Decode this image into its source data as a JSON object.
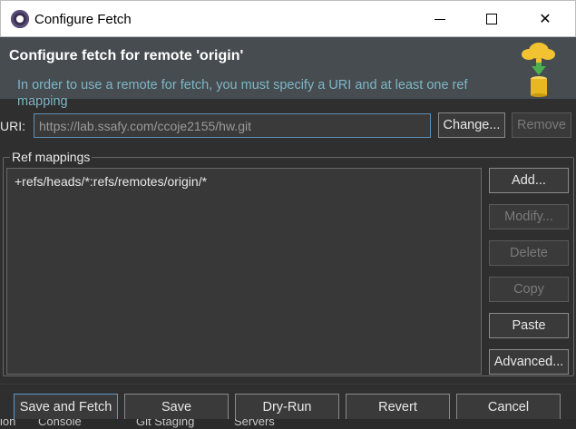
{
  "window": {
    "title": "Configure Fetch",
    "close_glyph": "✕"
  },
  "header": {
    "title": "Configure fetch for remote 'origin'",
    "message": "In order to use a remote for fetch, you must specify a URI and at least one ref mapping",
    "banner_icon": "cloud-fetch-icon"
  },
  "uri": {
    "label": "URI:",
    "value": "https://lab.ssafy.com/ccoje2155/hw.git",
    "change_label": "Change...",
    "remove_label": "Remove"
  },
  "ref_mappings": {
    "group_label": "Ref mappings",
    "items": [
      "+refs/heads/*:refs/remotes/origin/*"
    ],
    "buttons": {
      "add": "Add...",
      "modify": "Modify...",
      "delete": "Delete",
      "copy": "Copy",
      "paste": "Paste",
      "advanced": "Advanced..."
    }
  },
  "footer": {
    "save_and_fetch": "Save and Fetch",
    "save": "Save",
    "dry_run": "Dry-Run",
    "revert": "Revert",
    "cancel": "Cancel"
  },
  "background_tabs": {
    "items": [
      "ion",
      "Console",
      "Git Staging",
      "Servers"
    ]
  },
  "colors": {
    "header_bg": "#464c50",
    "message_text": "#7fb6c6",
    "dialog_bg": "#2f2f2f",
    "focus_border": "#5e9bc8"
  }
}
